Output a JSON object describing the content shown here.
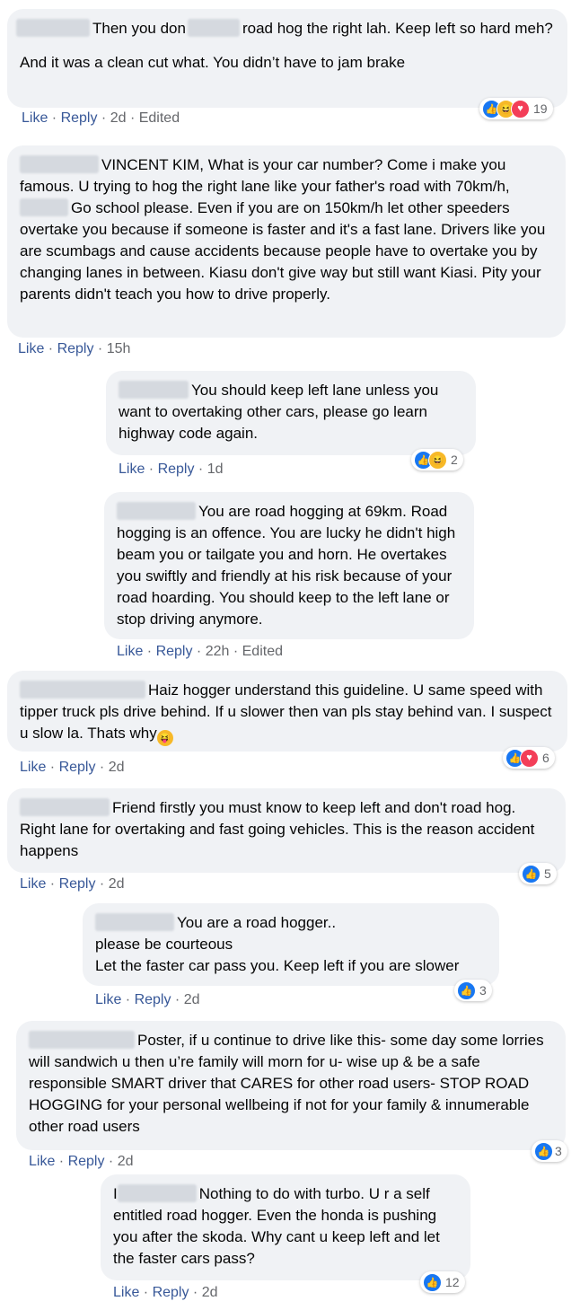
{
  "action_like": "Like",
  "action_reply": "Reply",
  "sep": " · ",
  "comments": [
    {
      "lines1": "Then you don",
      "lines1b": "road hog the right lah. Keep left so hard meh?",
      "text2": "And it was a clean cut what. You didn’t have to jam brake",
      "time": "2d",
      "edited": "Edited",
      "reactions": [
        "like",
        "haha",
        "love"
      ],
      "count": "19"
    },
    {
      "text": "VINCENT KIM, What is your car number? Come i make you famous. U trying to hog the right lane like your father's road with 70km/h,",
      "text_b": "Go school please. Even if you are on 150km/h let other speeders overtake you because if someone is faster and it's a fast lane. Drivers like you are scumbags and cause accidents because people have to overtake you by changing lanes in between. Kiasu don't give way but still want Kiasi. Pity your parents didn't teach you how to drive properly.",
      "time": "15h"
    },
    {
      "text": "You should keep left lane unless you want to overtaking other cars, please go learn highway code again.",
      "time": "1d",
      "reactions": [
        "like",
        "haha"
      ],
      "count": "2"
    },
    {
      "text": "You are road hogging at 69km. Road hogging is an offence. You are lucky he didn't high beam you or tailgate you and horn. He overtakes you swiftly and friendly at his risk because of your road hoarding. You should keep to the left lane or stop driving anymore.",
      "time": "22h",
      "edited": "Edited"
    },
    {
      "text": "Haiz hogger understand this guideline. U same speed with tipper truck pls drive behind. If u slower then van pls stay behind van. I suspect u slow la. Thats why",
      "time": "2d",
      "reactions": [
        "like",
        "love"
      ],
      "count": "6"
    },
    {
      "text": "Friend firstly you must know to keep left and don't road hog. Right lane for overtaking and fast going vehicles. This is the reason accident happens",
      "time": "2d",
      "reactions": [
        "like"
      ],
      "count": "5"
    },
    {
      "line1": "You are a road hogger..",
      "line2": "please be courteous",
      "line3": "Let the faster car pass you. Keep left if you are slower",
      "time": "2d",
      "reactions": [
        "like"
      ],
      "count": "3"
    },
    {
      "text": "Poster, if u continue to drive like this- some day some lorries will sandwich u then u’re family will morn for u- wise up & be a safe responsible SMART driver that CARES for other road users- STOP ROAD HOGGING for your personal wellbeing if not for your family & innumerable other road users",
      "time": "2d",
      "reactions": [
        "like"
      ],
      "count": "3"
    },
    {
      "prefix": "I",
      "text": "Nothing to do with turbo. U r a self entitled road hogger. Even the honda is pushing you after the skoda. Why cant u keep left and let the faster cars pass?",
      "time": "2d",
      "reactions": [
        "like"
      ],
      "count": "12"
    }
  ]
}
